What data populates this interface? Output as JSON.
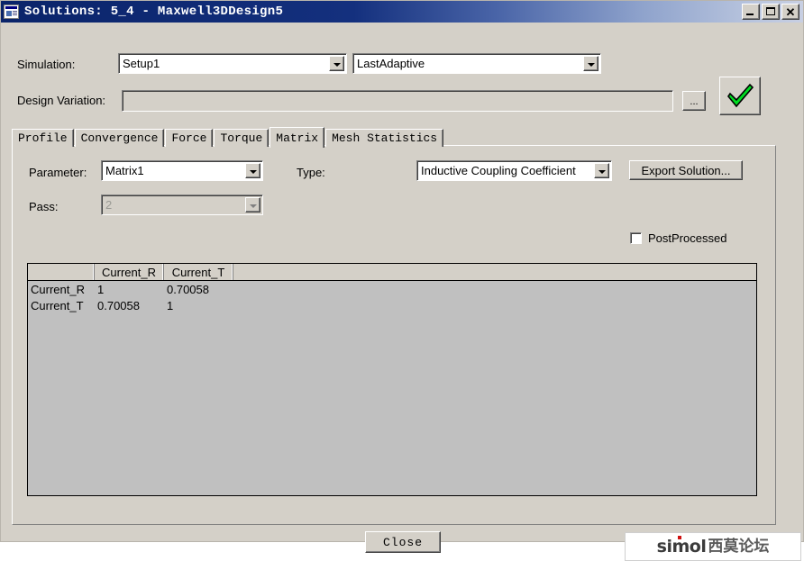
{
  "window": {
    "title": "Solutions: 5_4 - Maxwell3DDesign5",
    "icon": "window-dialog-icon",
    "controls": {
      "minimize": "_",
      "maximize": "□",
      "close": "✕"
    }
  },
  "form": {
    "simulation_label": "Simulation:",
    "simulation_value": "Setup1",
    "adaptive_value": "LastAdaptive",
    "design_variation_label": "Design Variation:",
    "design_variation_value": "",
    "browse_label": "...",
    "accept_icon": "green-check-icon"
  },
  "tabs": [
    {
      "label": "Profile",
      "active": false
    },
    {
      "label": "Convergence",
      "active": false
    },
    {
      "label": "Force",
      "active": false
    },
    {
      "label": "Torque",
      "active": false
    },
    {
      "label": "Matrix",
      "active": true
    },
    {
      "label": "Mesh Statistics",
      "active": false
    }
  ],
  "matrix_tab": {
    "parameter_label": "Parameter:",
    "parameter_value": "Matrix1",
    "type_label": "Type:",
    "type_value": "Inductive Coupling Coefficient",
    "export_label": "Export Solution...",
    "pass_label": "Pass:",
    "pass_value": "2",
    "pass_disabled": true,
    "postprocessed_label": "PostProcessed",
    "postprocessed_checked": false,
    "table": {
      "columns": [
        "",
        "Current_R",
        "Current_T",
        ""
      ],
      "rows": [
        {
          "header": "Current_R",
          "values": [
            "1",
            "0.70058",
            ""
          ]
        },
        {
          "header": "Current_T",
          "values": [
            "0.70058",
            "1",
            ""
          ]
        }
      ]
    }
  },
  "footer": {
    "close_label": "Close"
  },
  "watermark": {
    "latin": "simol",
    "cjk": "西莫论坛"
  },
  "colors": {
    "face": "#d4d0c8",
    "title_start": "#0a246a",
    "accent_green": "#00d820",
    "table_body": "#c0c0c0"
  }
}
